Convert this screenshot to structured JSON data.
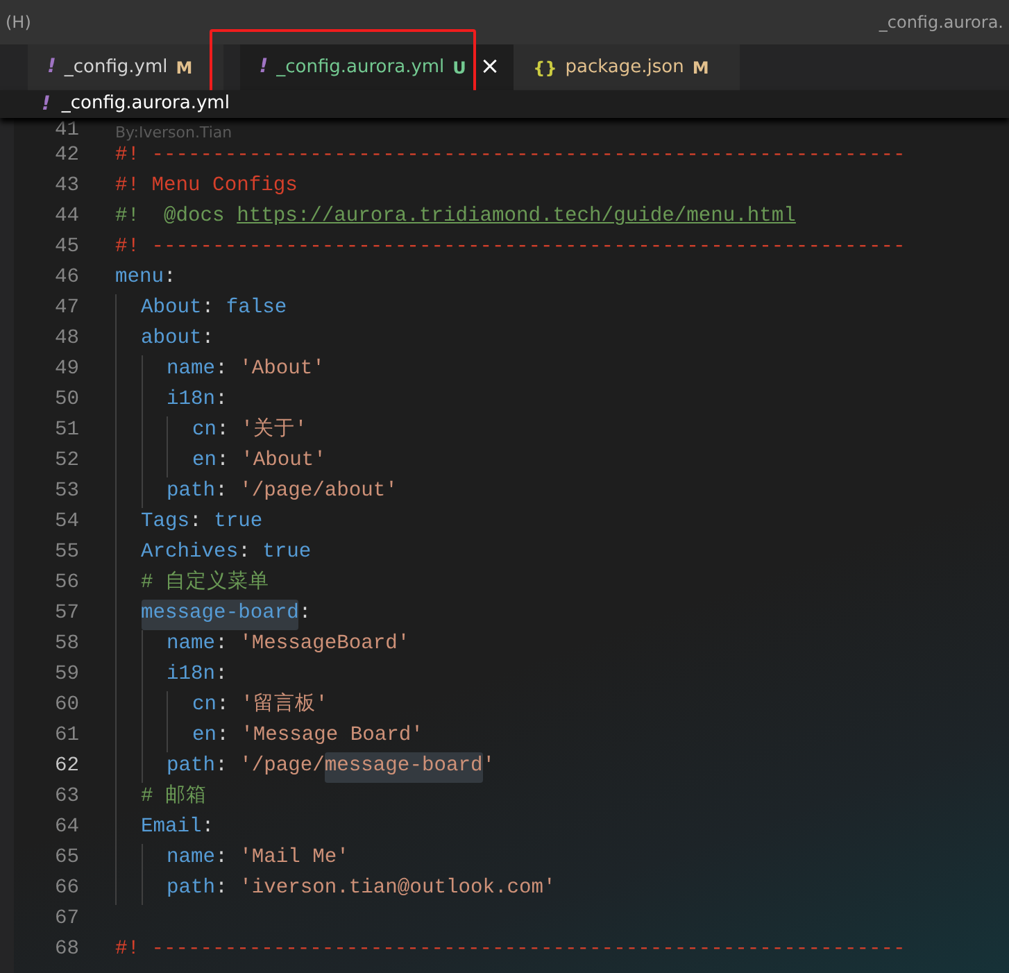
{
  "title_bar": {
    "menu_fragment": "(H)",
    "title": "_config.aurora."
  },
  "tabs": [
    {
      "icon": "!",
      "kind": "yaml",
      "label": "_config.yml",
      "status": "M",
      "selected": false
    },
    {
      "icon": "!",
      "kind": "yaml",
      "label": "_config.aurora.yml",
      "status": "U",
      "selected": true,
      "close": "×"
    },
    {
      "icon": "{}",
      "kind": "json",
      "label": "package.json",
      "status": "M",
      "selected": false
    }
  ],
  "breadcrumb": {
    "icon": "!",
    "label": "_config.aurora.yml"
  },
  "annotation": {
    "author": "By:Iverson.Tian"
  },
  "lines": [
    {
      "number": "41",
      "current": false
    },
    {
      "number": "42",
      "current": false,
      "tokens": [
        {
          "kind": "red",
          "text": "#! --------------------------------------------------------------"
        }
      ]
    },
    {
      "number": "43",
      "current": false,
      "tokens": [
        {
          "kind": "red",
          "text": "#! Menu Configs"
        }
      ]
    },
    {
      "number": "44",
      "current": false,
      "tokens": [
        {
          "kind": "green",
          "text": "#!  @docs "
        },
        {
          "kind": "link",
          "text": "https://aurora.tridiamond.tech/guide/menu.html"
        }
      ]
    },
    {
      "number": "45",
      "current": false,
      "tokens": [
        {
          "kind": "red",
          "text": "#! --------------------------------------------------------------"
        }
      ]
    },
    {
      "number": "46",
      "current": false,
      "tokens": [
        {
          "kind": "key",
          "text": "menu"
        },
        {
          "kind": "punct",
          "text": ":"
        }
      ]
    },
    {
      "number": "47",
      "current": false,
      "tokens": [
        {
          "kind": "key",
          "text": "  About"
        },
        {
          "kind": "punct",
          "text": ": "
        },
        {
          "kind": "bool",
          "text": "false"
        }
      ]
    },
    {
      "number": "48",
      "current": false,
      "tokens": [
        {
          "kind": "key",
          "text": "  about"
        },
        {
          "kind": "punct",
          "text": ":"
        }
      ]
    },
    {
      "number": "49",
      "current": false,
      "tokens": [
        {
          "kind": "key",
          "text": "    name"
        },
        {
          "kind": "punct",
          "text": ": "
        },
        {
          "kind": "string",
          "text": "'About'"
        }
      ]
    },
    {
      "number": "50",
      "current": false,
      "tokens": [
        {
          "kind": "key",
          "text": "    i18n"
        },
        {
          "kind": "punct",
          "text": ":"
        }
      ]
    },
    {
      "number": "51",
      "current": false,
      "tokens": [
        {
          "kind": "key",
          "text": "      cn"
        },
        {
          "kind": "punct",
          "text": ": "
        },
        {
          "kind": "string",
          "text": "'关于'"
        }
      ]
    },
    {
      "number": "52",
      "current": false,
      "tokens": [
        {
          "kind": "key",
          "text": "      en"
        },
        {
          "kind": "punct",
          "text": ": "
        },
        {
          "kind": "string",
          "text": "'About'"
        }
      ]
    },
    {
      "number": "53",
      "current": false,
      "tokens": [
        {
          "kind": "key",
          "text": "    path"
        },
        {
          "kind": "punct",
          "text": ": "
        },
        {
          "kind": "string",
          "text": "'/page/about'"
        }
      ]
    },
    {
      "number": "54",
      "current": false,
      "tokens": [
        {
          "kind": "key",
          "text": "  Tags"
        },
        {
          "kind": "punct",
          "text": ": "
        },
        {
          "kind": "bool",
          "text": "true"
        }
      ]
    },
    {
      "number": "55",
      "current": false,
      "tokens": [
        {
          "kind": "key",
          "text": "  Archives"
        },
        {
          "kind": "punct",
          "text": ": "
        },
        {
          "kind": "bool",
          "text": "true"
        }
      ]
    },
    {
      "number": "56",
      "current": false,
      "tokens": [
        {
          "kind": "green",
          "text": "  # 自定义菜单"
        }
      ]
    },
    {
      "number": "57",
      "current": false,
      "tokens": [
        {
          "kind": "key",
          "text": "  message-board",
          "highlighted": true
        },
        {
          "kind": "punct",
          "text": ":"
        }
      ]
    },
    {
      "number": "58",
      "current": false,
      "tokens": [
        {
          "kind": "key",
          "text": "    name"
        },
        {
          "kind": "punct",
          "text": ": "
        },
        {
          "kind": "string",
          "text": "'MessageBoard'"
        }
      ]
    },
    {
      "number": "59",
      "current": false,
      "tokens": [
        {
          "kind": "key",
          "text": "    i18n"
        },
        {
          "kind": "punct",
          "text": ":"
        }
      ]
    },
    {
      "number": "60",
      "current": false,
      "tokens": [
        {
          "kind": "key",
          "text": "      cn"
        },
        {
          "kind": "punct",
          "text": ": "
        },
        {
          "kind": "string",
          "text": "'留言板'"
        }
      ]
    },
    {
      "number": "61",
      "current": false,
      "tokens": [
        {
          "kind": "key",
          "text": "      en"
        },
        {
          "kind": "punct",
          "text": ": "
        },
        {
          "kind": "string",
          "text": "'Message Board'"
        }
      ]
    },
    {
      "number": "62",
      "current": true,
      "tokens": [
        {
          "kind": "key",
          "text": "    path"
        },
        {
          "kind": "punct",
          "text": ": "
        },
        {
          "kind": "string",
          "text": "'/page/"
        },
        {
          "kind": "string",
          "text": "message-board",
          "highlighted": true
        },
        {
          "kind": "string",
          "text": "'"
        }
      ]
    },
    {
      "number": "63",
      "current": false,
      "tokens": [
        {
          "kind": "green",
          "text": "  # 邮箱"
        }
      ]
    },
    {
      "number": "64",
      "current": false,
      "tokens": [
        {
          "kind": "key",
          "text": "  Email"
        },
        {
          "kind": "punct",
          "text": ":"
        }
      ]
    },
    {
      "number": "65",
      "current": false,
      "tokens": [
        {
          "kind": "key",
          "text": "    name"
        },
        {
          "kind": "punct",
          "text": ": "
        },
        {
          "kind": "string",
          "text": "'Mail Me'"
        }
      ]
    },
    {
      "number": "66",
      "current": false,
      "tokens": [
        {
          "kind": "key",
          "text": "    path"
        },
        {
          "kind": "punct",
          "text": ": "
        },
        {
          "kind": "string",
          "text": "'iverson.tian@outlook.com'"
        }
      ]
    },
    {
      "number": "67",
      "current": false
    },
    {
      "number": "68",
      "current": false,
      "tokens": [
        {
          "kind": "red",
          "text": "#! --------------------------------------------------------------"
        }
      ]
    }
  ]
}
